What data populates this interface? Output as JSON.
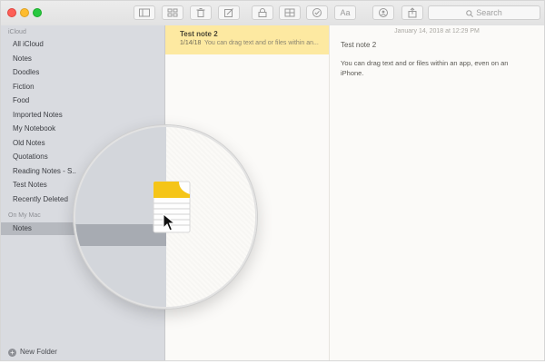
{
  "toolbar": {
    "buttons": [
      "sidebar-icon",
      "gallery-icon",
      "trash-icon",
      "compose-icon",
      "lock-icon",
      "table-icon",
      "checklist-icon",
      "format-icon",
      "share-people-icon",
      "share-icon"
    ],
    "format_label": "Aa",
    "search_placeholder": "Search"
  },
  "sidebar": {
    "icloud_header": "iCloud",
    "icloud_items": [
      "All iCloud",
      "Notes",
      "Doodles",
      "Fiction",
      "Food",
      "Imported Notes",
      "My Notebook",
      "Old Notes",
      "Quotations",
      "Reading Notes - S..",
      "Test Notes",
      "Recently Deleted"
    ],
    "mac_header": "On My Mac",
    "mac_selected": "Notes",
    "new_folder": "New Folder"
  },
  "note_list": {
    "selected": {
      "title": "Test note 2",
      "date": "1/14/18",
      "snippet": "You can drag text and or files within an..."
    }
  },
  "editor": {
    "date": "January 14, 2018 at 12:29 PM",
    "title": "Test note 2",
    "body": "You can drag text and or files within an app, even on an iPhone."
  },
  "colors": {
    "sidebar_bg": "#d9dbe0",
    "selected_note": "#fde9a1",
    "folder_icon": "#f5c518"
  }
}
